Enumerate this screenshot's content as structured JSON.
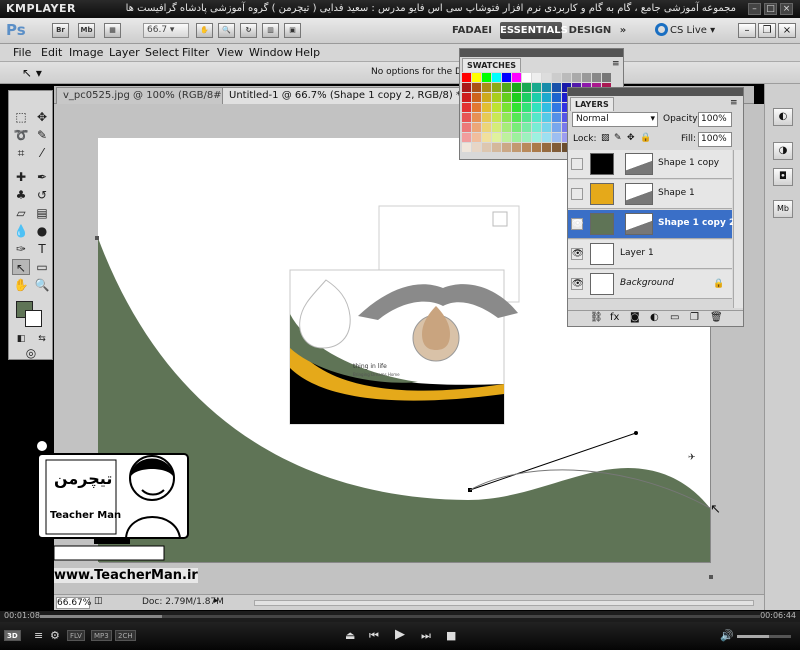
{
  "player": {
    "logo": "KMPLAYER",
    "title": "مجموعه آموزشی جامع ، گام به گام و کاربردی نرم افزار فتوشاپ سی اس فایو مدرس : سعید فدایی ( تیچرمن ) گروه آموزشی پادشاه گرافیست ها",
    "time_elapsed": "00:01:08",
    "time_total": "00:06:44",
    "progress": 0.17,
    "volume": 0.6,
    "badges": [
      "FLV",
      "MP3",
      "2CH"
    ],
    "mode_badge": "3D"
  },
  "app": {
    "logo": "Ps",
    "bridge_label": "Br",
    "minibridge_label": "Mb",
    "zoom_dropdown": "66.7",
    "workspaces": [
      "FADAEI",
      "ESSENTIALS",
      "DESIGN"
    ],
    "active_workspace": "ESSENTIALS",
    "more_workspaces": "»",
    "cs_live": "CS Live"
  },
  "menu": [
    "File",
    "Edit",
    "Image",
    "Layer",
    "Select",
    "Filter",
    "View",
    "Window",
    "Help"
  ],
  "options_bar": {
    "message": "No options for the Direct"
  },
  "doc_tabs": [
    {
      "label": "v_pc0525.jpg @ 100% (RGB/8#)",
      "active": false
    },
    {
      "label": "Untitled-1 @ 66.7% (Shape 1 copy 2, RGB/8) *",
      "active": true
    }
  ],
  "status": {
    "zoom": "66.67%",
    "doc": "Doc: 2.79M/1.87M"
  },
  "swatches_panel": {
    "title": "SWATCHES"
  },
  "layers_panel": {
    "title": "LAYERS",
    "blend_mode": "Normal",
    "opacity_label": "Opacity:",
    "opacity": "100%",
    "lock_label": "Lock:",
    "fill_label": "Fill:",
    "fill": "100%",
    "layers": [
      {
        "name": "Shape 1 copy",
        "visible": false,
        "selected": false,
        "thumb": "#000000",
        "italic": false
      },
      {
        "name": "Shape 1",
        "visible": false,
        "selected": false,
        "thumb": "#e5a91a",
        "italic": false
      },
      {
        "name": "Shape 1 copy 2",
        "visible": true,
        "selected": true,
        "thumb": "#5f7456",
        "italic": false
      },
      {
        "name": "Layer 1",
        "visible": true,
        "selected": false,
        "thumb": "#ffffff",
        "italic": false
      },
      {
        "name": "Background",
        "visible": true,
        "selected": false,
        "thumb": "#ffffff",
        "italic": true
      }
    ]
  },
  "canvas": {
    "shape_color": "#5f7456",
    "preview_text_1": "thing in life",
    "preview_text_2": "Bringing Dreams Home"
  },
  "watermark": {
    "logo_text": "تیچرمن",
    "name": "Teacher Man",
    "url": "www.TeacherMan.ir"
  },
  "colors": {
    "foreground": "#5f7456",
    "background": "#ffffff",
    "selection": "#3a6fc7"
  }
}
